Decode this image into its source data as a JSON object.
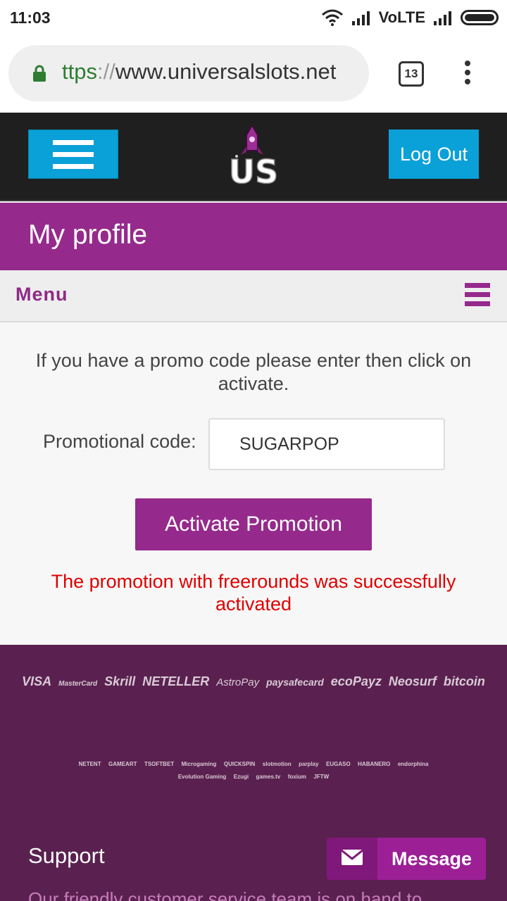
{
  "status_bar": {
    "time": "11:03",
    "network": "VoLTE"
  },
  "browser": {
    "url_scheme": "ttps",
    "url_sep": "://",
    "url_host": "www.universalslots.net",
    "tab_count": "13"
  },
  "header": {
    "logo_text": "US",
    "logout_label": "Log Out"
  },
  "page": {
    "title": "My profile"
  },
  "menu": {
    "label": "Menu"
  },
  "promo": {
    "intro": "If you have a promo code please enter then click on activate.",
    "label": "Promotional code:",
    "value": "SUGARPOP",
    "button_label": "Activate Promotion",
    "success_message": "The promotion with freerounds was successfully activated"
  },
  "footer": {
    "payment_methods": [
      "VISA",
      "MasterCard",
      "Skrill",
      "NETELLER",
      "AstroPay",
      "paysafecard",
      "ecoPayz",
      "Neosurf",
      "bitcoin"
    ],
    "providers": [
      "NETENT",
      "GAMEART",
      "TSOFTBET",
      "Microgaming",
      "QUICKSPIN",
      "slotmotion",
      "parplay",
      "EUGASO",
      "HABANERO",
      "endorphina",
      "Evolution Gaming",
      "Ezugi",
      "games.tv",
      "foxium",
      "JFTW"
    ],
    "support_title": "Support",
    "support_text": "Our friendly customer service team is on hand to",
    "message_label": "Message"
  },
  "colors": {
    "brand_purple": "#952a8c",
    "accent_blue": "#0aa0d8",
    "footer_bg": "#5a2150",
    "success_red": "#e00000"
  }
}
